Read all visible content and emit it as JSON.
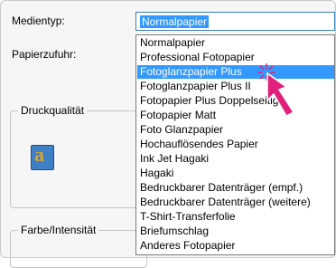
{
  "labels": {
    "media_type": "Medientyp:",
    "paper_feed": "Papierzufuhr:",
    "print_quality": "Druckqualität",
    "color_intensity": "Farbe/Intensität"
  },
  "combo": {
    "value": "Normalpapier"
  },
  "dropdown": {
    "items": [
      "Normalpapier",
      "Professional Fotopapier",
      "Fotoglanzpapier Plus",
      "Fotoglanzpapier Plus II",
      "Fotopapier Plus Doppelseitig",
      "Fotopapier Matt",
      "Foto Glanzpapier",
      "Hochauflösendes Papier",
      "Ink Jet Hagaki",
      "Hagaki",
      "Bedruckbarer Datenträger (empf.)",
      "Bedruckbarer Datenträger (weitere)",
      "T-Shirt-Transferfolie",
      "Briefumschlag",
      "Anderes Fotopapier"
    ],
    "selected_index": 2
  },
  "preview": {
    "glyph": "a"
  },
  "colors": {
    "highlight": "#3399ff",
    "cursor": "#e0207a"
  },
  "icons": {
    "cursor": "hand-pointer-icon",
    "preview": "print-quality-preview-icon"
  }
}
